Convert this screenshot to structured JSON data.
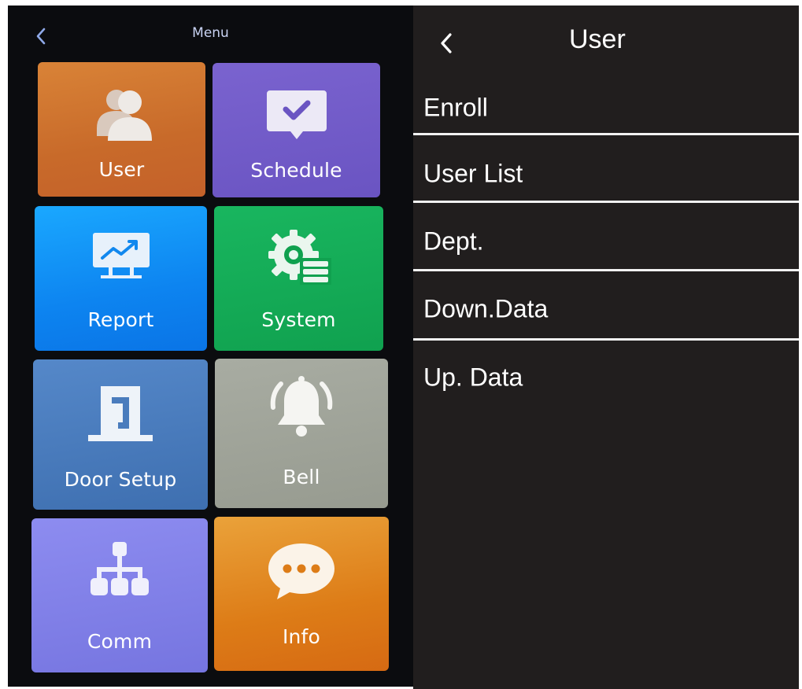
{
  "left_screen": {
    "title": "Menu",
    "back_icon": "chevron-left-icon",
    "tiles": [
      {
        "label": "User",
        "icon": "users-icon",
        "color": "#d07530"
      },
      {
        "label": "Schedule",
        "icon": "calendar-check-icon",
        "color": "#7260c9"
      },
      {
        "label": "Report",
        "icon": "chart-board-icon",
        "color": "#1393f5"
      },
      {
        "label": "System",
        "icon": "gear-list-icon",
        "color": "#15ab57"
      },
      {
        "label": "Door Setup",
        "icon": "door-icon",
        "color": "#4a7cbd"
      },
      {
        "label": "Bell",
        "icon": "bell-icon",
        "color": "#a0a499"
      },
      {
        "label": "Comm",
        "icon": "network-icon",
        "color": "#8281e8"
      },
      {
        "label": "Info",
        "icon": "chat-bubble-icon",
        "color": "#e08a24"
      }
    ]
  },
  "right_screen": {
    "title": "User",
    "back_icon": "chevron-left-icon",
    "items": [
      {
        "label": "Enroll"
      },
      {
        "label": "User List"
      },
      {
        "label": "Dept."
      },
      {
        "label": "Down.Data"
      },
      {
        "label": "Up. Data"
      }
    ]
  },
  "colors": {
    "right_background": "#211e1e",
    "left_background": "#0b0c0f",
    "divider": "#f2f2f2",
    "text": "#ffffff"
  }
}
